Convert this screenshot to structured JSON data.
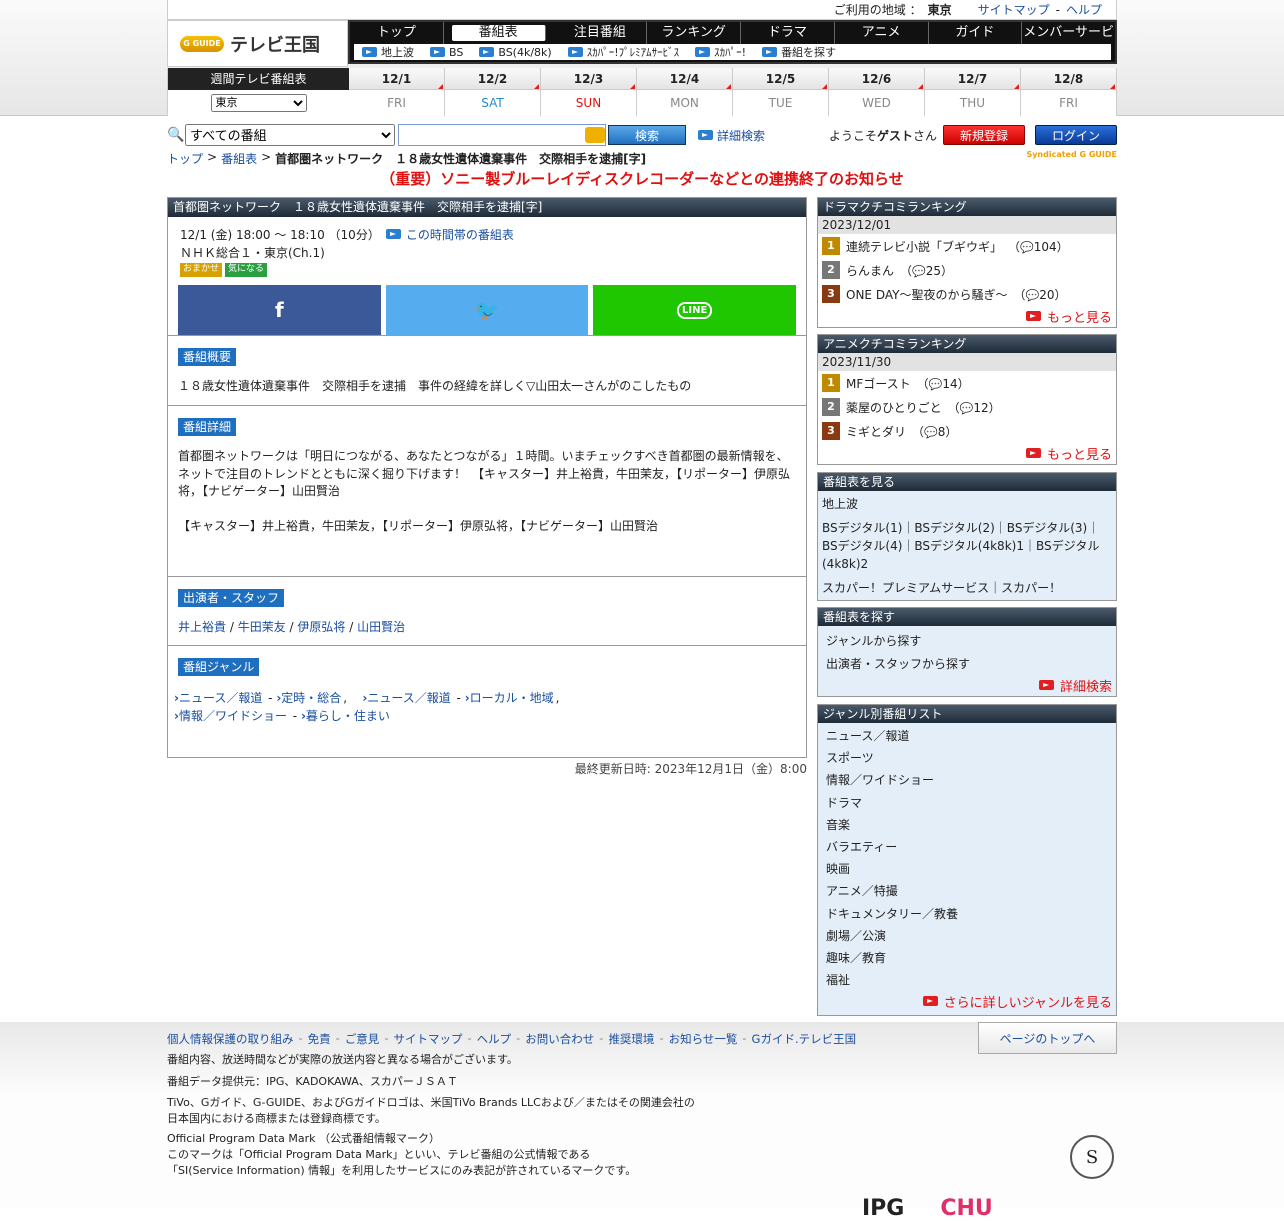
{
  "util": {
    "area_label": "ご利用の地域 ：",
    "area": "東京",
    "sitemap": "サイトマップ",
    "sep": "-",
    "help": "ヘルプ"
  },
  "logo": {
    "badge": "G GUIDE",
    "text": "テレビ王国"
  },
  "nav": {
    "items": [
      "トップ",
      "番組表",
      "注目番組",
      "ランキング",
      "ドラマ",
      "アニメ",
      "ガイド",
      "メンバーサービス"
    ],
    "sub": [
      "地上波",
      "BS",
      "BS(4k/8k)",
      "ｽｶﾊﾟｰ!ﾌﾟﾚﾐｱﾑｻｰﾋﾞｽ",
      "ｽｶﾊﾟｰ!",
      "番組を探す"
    ]
  },
  "datebar": {
    "label": "週間テレビ番組表",
    "region": "東京",
    "days": [
      {
        "d": "12/1",
        "w": "FRI"
      },
      {
        "d": "12/2",
        "w": "SAT"
      },
      {
        "d": "12/3",
        "w": "SUN"
      },
      {
        "d": "12/4",
        "w": "MON"
      },
      {
        "d": "12/5",
        "w": "TUE"
      },
      {
        "d": "12/6",
        "w": "WED"
      },
      {
        "d": "12/7",
        "w": "THU"
      },
      {
        "d": "12/8",
        "w": "FRI"
      }
    ]
  },
  "search": {
    "scope": "すべての番組",
    "button": "検索",
    "advanced": "詳細検索",
    "welcome_pre": "ようこそ",
    "guest": "ゲスト",
    "welcome_post": "さん",
    "register": "新規登録",
    "login": "ログイン"
  },
  "breadcrumb": {
    "top": "トップ",
    "sep": ">",
    "schedule": "番組表",
    "current": "首都圏ネットワーク　１８歳女性遺体遺棄事件　交際相手を逮捕[字]",
    "syndicated": "Syndicated G GUIDE"
  },
  "notice": "（重要）ソニー製ブルーレイディスクレコーダーなどとの連携終了のお知らせ",
  "program": {
    "title": "首都圏ネットワーク　１８歳女性遺体遺棄事件　交際相手を逮捕[字]",
    "time": "12/1 (金) 18:00 ～ 18:10 （10分）",
    "slot_link": "この時間帯の番組表",
    "channel": "ＮＨＫ総合１・東京(Ch.1)",
    "tag1": "おまかせ",
    "tag2": "気になる",
    "share": {
      "facebook": "f",
      "twitter": "🐦",
      "line": "LINE"
    },
    "summary_h": "番組概要",
    "summary": "１８歳女性遺体遺棄事件　交際相手を逮捕　事件の経緯を詳しく▽山田太一さんがのこしたもの",
    "detail_h": "番組詳細",
    "detail1": "首都圏ネットワークは「明日につながる、あなたとつながる」１時間。いまチェックすべき首都圏の最新情報を、ネットで注目のトレンドとともに深く掘り下げます！　【キャスター】井上裕貴，牛田茉友，【リポーター】伊原弘将，【ナビゲーター】山田賢治",
    "detail2": "【キャスター】井上裕貴，牛田茉友，【リポーター】伊原弘将，【ナビゲーター】山田賢治",
    "cast_h": "出演者・スタッフ",
    "cast": [
      "井上裕貴",
      "牛田茉友",
      "伊原弘将",
      "山田賢治"
    ],
    "genre_h": "番組ジャンル",
    "genres": [
      [
        "ニュース／報道",
        "定時・総合"
      ],
      [
        "ニュース／報道",
        "ローカル・地域"
      ],
      [
        "情報／ワイドショー",
        "暮らし・住まい"
      ]
    ]
  },
  "updated": "最終更新日時: 2023年12月1日（金）8:00",
  "drama": {
    "title": "ドラマクチコミランキング",
    "date": "2023/12/01",
    "items": [
      {
        "name": "連続テレビ小説「ブギウギ」",
        "count": "104"
      },
      {
        "name": "らんまん",
        "count": "25"
      },
      {
        "name": "ONE DAY～聖夜のから騒ぎ～",
        "count": "20"
      }
    ],
    "more": "もっと見る"
  },
  "anime": {
    "title": "アニメクチコミランキング",
    "date": "2023/11/30",
    "items": [
      {
        "name": "MFゴースト",
        "count": "14"
      },
      {
        "name": "薬屋のひとりごと",
        "count": "12"
      },
      {
        "name": "ミギとダリ",
        "count": "8"
      }
    ],
    "more": "もっと見る"
  },
  "viewsched": {
    "title": "番組表を見る",
    "l1": "地上波",
    "l2": "BSデジタル(1)｜BSデジタル(2)｜BSデジタル(3)｜BSデジタル(4)｜BSデジタル(4k8k)1｜BSデジタル(4k8k)2",
    "l3": "スカパー！プレミアムサービス｜スカパー！"
  },
  "findsched": {
    "title": "番組表を探す",
    "items": [
      "ジャンルから探す",
      "出演者・スタッフから探す"
    ],
    "more": "詳細検索"
  },
  "genrelist": {
    "title": "ジャンル別番組リスト",
    "items": [
      "ニュース／報道",
      "スポーツ",
      "情報／ワイドショー",
      "ドラマ",
      "音楽",
      "バラエティー",
      "映画",
      "アニメ／特撮",
      "ドキュメンタリー／教養",
      "劇場／公演",
      "趣味／教育",
      "福祉"
    ],
    "more": "さらに詳しいジャンルを見る"
  },
  "footer": {
    "links": [
      "個人情報保護の取り組み",
      "免責",
      "ご意見",
      "サイトマップ",
      "ヘルプ",
      "お問い合わせ",
      "推奨環境",
      "お知らせ一覧",
      "Gガイド.テレビ王国"
    ],
    "totop": "ページのトップへ",
    "p1": "番組内容、放送時間などが実際の放送内容と異なる場合がございます。",
    "p2": "番組データ提供元：IPG、KADOKAWA、スカパーＪＳＡＴ",
    "p3": "TiVo、Gガイド、G-GUIDE、およびGガイドロゴは、米国TiVo Brands LLCおよび／またはその関連会社の日本国内における商標または登録商標です。",
    "p4": "Official Program Data Mark （公式番組情報マーク）",
    "p5": "このマークは「Official Program Data Mark」といい、テレビ番組の公式情報である「SI(Service Information) 情報」を利用したサービスにのみ表記が許されているマークです。",
    "seal": "S",
    "logo1": "IPG",
    "logo2": "CHU"
  }
}
